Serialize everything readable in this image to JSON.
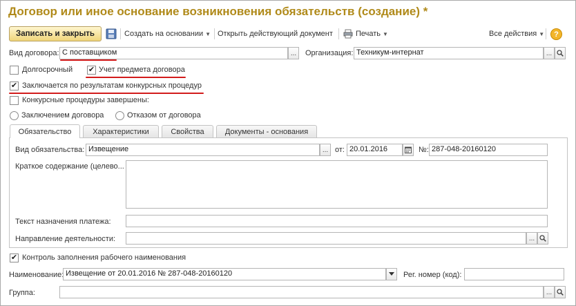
{
  "title": "Договор или иное основание возникновения обязательств (создание) *",
  "toolbar": {
    "save_close": "Записать и закрыть",
    "create_based": "Создать на основании",
    "open_current": "Открыть действующий документ",
    "print": "Печать",
    "all_actions": "Все действия",
    "help": "?"
  },
  "form": {
    "contract_type_label": "Вид договора:",
    "contract_type_value": "С поставщиком",
    "organization_label": "Организация:",
    "organization_value": "Техникум-интернат",
    "longterm_label": "Долгосрочный",
    "subject_label": "Учет предмета договора",
    "competitive_label": "Заключается по результатам конкурсных процедур",
    "procedures_done_label": "Конкурсные процедуры завершены:",
    "radio_conclusion": "Заключением договора",
    "radio_refusal": "Отказом от договора",
    "ellipsis": "...",
    "states": {
      "longterm": false,
      "subject": true,
      "competitive": true,
      "procedures_done": false,
      "control": true
    }
  },
  "tabs": [
    "Обязательство",
    "Характеристики",
    "Свойства",
    "Документы - основания"
  ],
  "obligation": {
    "kind_label": "Вид обязательства:",
    "kind_value": "Извещение",
    "from_label": "от:",
    "date_value": "20.01.2016",
    "number_label": "№:",
    "number_value": "287-048-20160120",
    "summary_label": "Краткое содержание (целево...",
    "payment_label": "Текст назначения платежа:",
    "direction_label": "Направление деятельности:"
  },
  "bottom": {
    "control_label": "Контроль заполнения рабочего наименования",
    "name_label": "Наименование:",
    "name_value": "Извещение от 20.01.2016 № 287-048-20160120",
    "reg_label": "Рег. номер (код):",
    "group_label": "Группа:"
  },
  "icons": [
    "save-disk-icon",
    "printer-icon",
    "calendar-icon",
    "search-icon",
    "check-icon",
    "dropdown-arrow-icon"
  ],
  "colors": {
    "title": "#b08a1a",
    "annotation": "#d21b1b",
    "primary_button": "#f0d57a"
  }
}
